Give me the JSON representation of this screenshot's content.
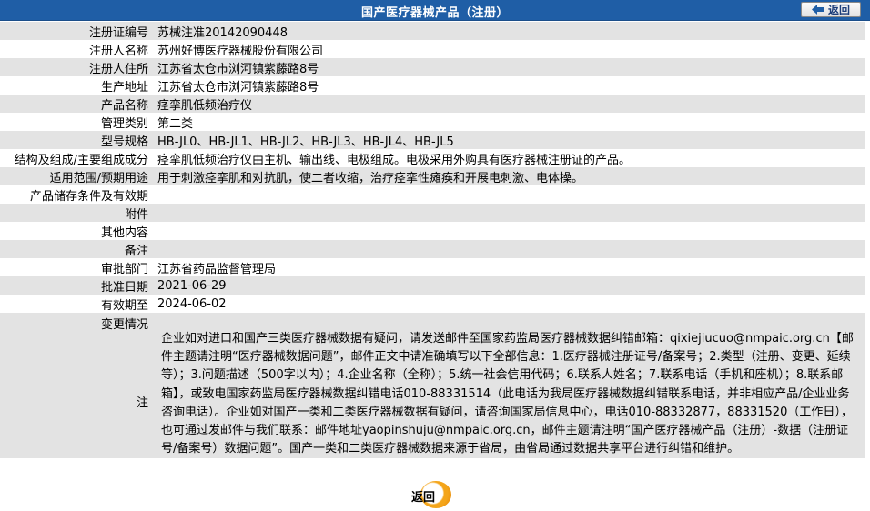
{
  "title": "国产医疗器械产品（注册）",
  "back_top_label": "返回",
  "back_bottom_label": "返回",
  "rows": [
    {
      "label": "注册证编号",
      "value": "苏械注准20142090448"
    },
    {
      "label": "注册人名称",
      "value": "苏州好博医疗器械股份有限公司"
    },
    {
      "label": "注册人住所",
      "value": "江苏省太仓市浏河镇紫藤路8号"
    },
    {
      "label": "生产地址",
      "value": "江苏省太仓市浏河镇紫藤路8号"
    },
    {
      "label": "产品名称",
      "value": "痉挛肌低频治疗仪"
    },
    {
      "label": "管理类别",
      "value": "第二类"
    },
    {
      "label": "型号规格",
      "value": "HB-JL0、HB-JL1、HB-JL2、HB-JL3、HB-JL4、HB-JL5"
    },
    {
      "label": "结构及组成/主要组成成分",
      "value": "痉挛肌低频治疗仪由主机、输出线、电极组成。电极采用外购具有医疗器械注册证的产品。"
    },
    {
      "label": "适用范围/预期用途",
      "value": "用于刺激痉挛肌和对抗肌，使二者收缩，治疗痉挛性瘫痪和开展电刺激、电体操。"
    },
    {
      "label": "产品储存条件及有效期",
      "value": ""
    },
    {
      "label": "附件",
      "value": ""
    },
    {
      "label": "其他内容",
      "value": ""
    },
    {
      "label": "备注",
      "value": ""
    },
    {
      "label": "审批部门",
      "value": "江苏省药品监督管理局"
    },
    {
      "label": "批准日期",
      "value": "2021-06-29"
    },
    {
      "label": "有效期至",
      "value": "2024-06-02"
    },
    {
      "label": "变更情况",
      "value": ""
    }
  ],
  "note": {
    "label": "注",
    "text": "企业如对进口和国产三类医疗器械数据有疑问，请发送邮件至国家药监局医疗器械数据纠错邮箱：qixiejiucuo@nmpaic.org.cn【邮件主题请注明“医疗器械数据问题”，邮件正文中请准确填写以下全部信息：1.医疗器械注册证号/备案号；2.类型（注册、变更、延续等）；3.问题描述（500字以内）；4.企业名称（全称）；5.统一社会信用代码；6.联系人姓名；7.联系电话（手机和座机）；8.联系邮箱】，或致电国家药监局医疗器械数据纠错电话010-88331514（此电话为我局医疗器械数据纠错联系电话，并非相应产品/企业业务咨询电话）。企业如对国产一类和二类医疗器械数据有疑问，请咨询国家局信息中心，电话010-88332877，88331520（工作日），也可通过发邮件与我们联系：邮件地址yaopinshuju@nmpaic.org.cn，邮件主题请注明“国产医疗器械产品（注册）-数据（注册证号/备案号）数据问题”。国产一类和二类医疗器械数据来源于省局，由省局通过数据共享平台进行纠错和维护。"
  },
  "colors": {
    "title_bar": "#1f5ea6",
    "row_alt_gray": "#e3e3e3",
    "back_ring": "#f4a51a"
  }
}
